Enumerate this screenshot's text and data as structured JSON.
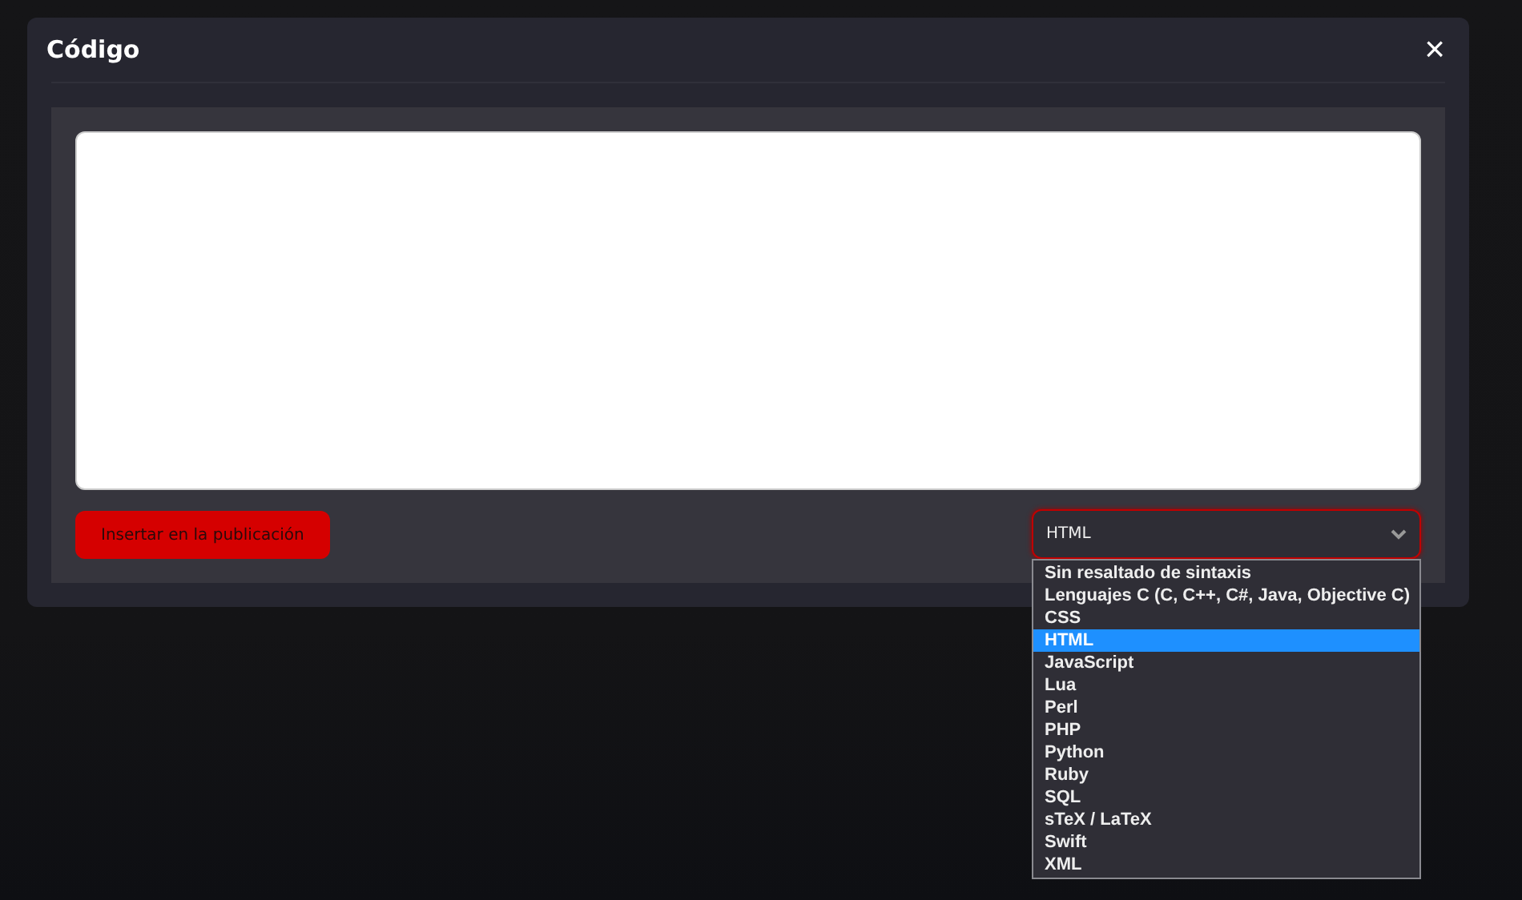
{
  "dialog": {
    "title": "Código",
    "close_label": "×"
  },
  "insert_button": "Insertar en la publicación",
  "language_select": {
    "value": "HTML",
    "expanded": true,
    "options": [
      {
        "label": "Sin resaltado de sintaxis",
        "selected": false
      },
      {
        "label": "Lenguajes C (C, C++, C#, Java, Objective C)",
        "selected": false
      },
      {
        "label": "CSS",
        "selected": false
      },
      {
        "label": "HTML",
        "selected": true
      },
      {
        "label": "JavaScript",
        "selected": false
      },
      {
        "label": "Lua",
        "selected": false
      },
      {
        "label": "Perl",
        "selected": false
      },
      {
        "label": "PHP",
        "selected": false
      },
      {
        "label": "Python",
        "selected": false
      },
      {
        "label": "Ruby",
        "selected": false
      },
      {
        "label": "SQL",
        "selected": false
      },
      {
        "label": "sTeX / LaTeX",
        "selected": false
      },
      {
        "label": "Swift",
        "selected": false
      },
      {
        "label": "XML",
        "selected": false
      }
    ]
  }
}
